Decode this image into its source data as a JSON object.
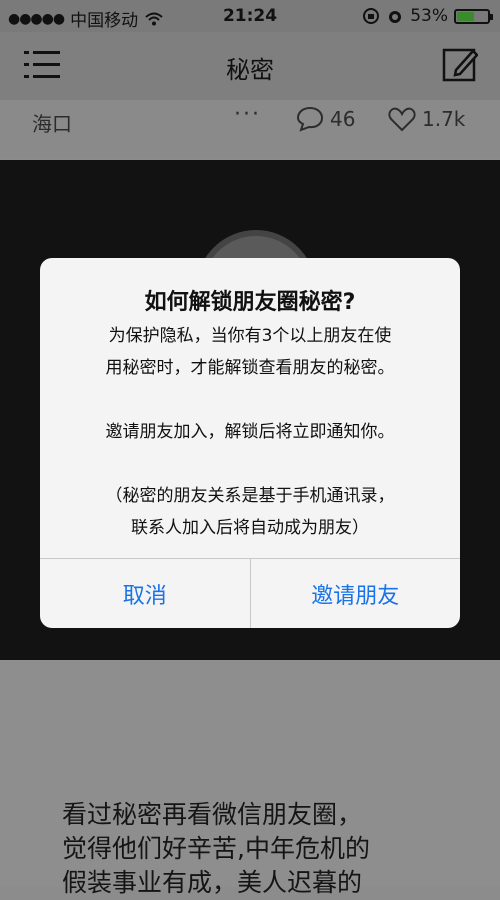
{
  "status_bar": {
    "carrier": "中国移动",
    "time": "21:24",
    "battery": "53%",
    "battery_level": 0.53
  },
  "navbar": {
    "title": "秘密"
  },
  "post_meta": {
    "location": "海口",
    "more": "···",
    "comments": "46",
    "likes": "1.7k"
  },
  "dialog": {
    "title": "如何解锁朋友圈秘密?",
    "lines1": [
      "为保护隐私，当你有3个以上朋友在使",
      "用秘密时，才能解锁查看朋友的秘密。"
    ],
    "line2": "邀请朋友加入，解锁后将立即通知你。",
    "lines3": [
      "（秘密的朋友关系是基于手机通讯录，",
      "联系人加入后将自动成为朋友）"
    ],
    "cancel_label": "取消",
    "invite_label": "邀请朋友"
  },
  "content": {
    "lines": [
      "看过秘密再看微信朋友圈，",
      "觉得他们好辛苦,中年危机的",
      "假装事业有成，美人迟暮的"
    ]
  },
  "colors": {
    "accent": "#1a73e8",
    "battery_fill": "#3c8a2e"
  }
}
